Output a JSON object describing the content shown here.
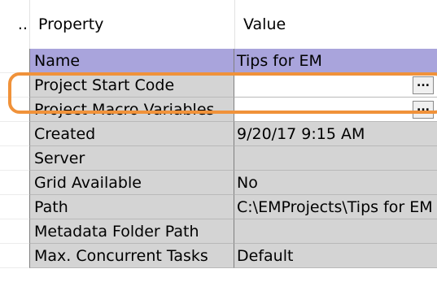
{
  "header": {
    "gutter_label": "..",
    "property_label": "Property",
    "value_label": "Value"
  },
  "rows": [
    {
      "property": "Name",
      "value": "Tips for EM"
    },
    {
      "property": "Project Start Code",
      "value": ""
    },
    {
      "property": "Project Macro Variables",
      "value": ""
    },
    {
      "property": "Created",
      "value": "9/20/17 9:15 AM"
    },
    {
      "property": "Server",
      "value": ""
    },
    {
      "property": "Grid Available",
      "value": "No"
    },
    {
      "property": "Path",
      "value": "C:\\EMProjects\\Tips for EM"
    },
    {
      "property": "Metadata Folder Path",
      "value": ""
    },
    {
      "property": "Max. Concurrent Tasks",
      "value": "Default"
    }
  ],
  "buttons": {
    "ellipsis_label": "..."
  },
  "colors": {
    "selected_row": "#a9a4dc",
    "cell_gray": "#d4d4d4",
    "highlight": "#f0923a"
  }
}
